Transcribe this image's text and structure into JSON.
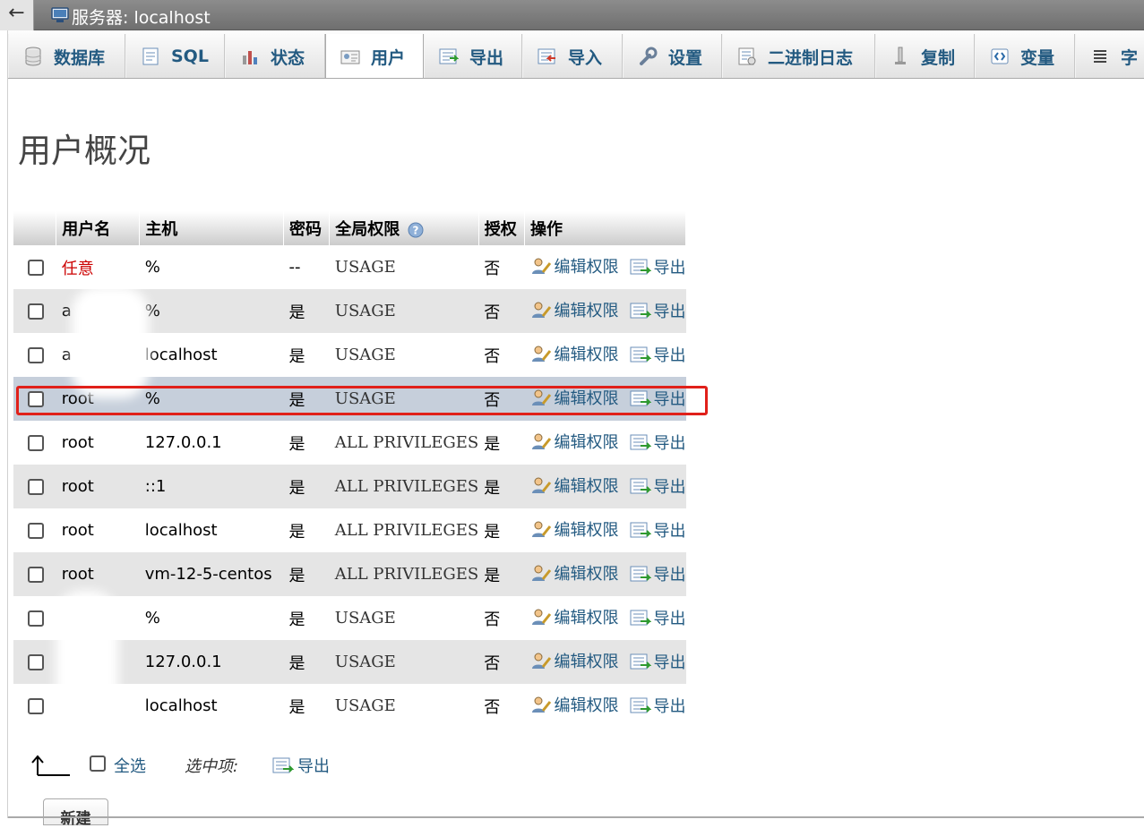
{
  "window": {
    "title": "服务器: localhost",
    "back": "←"
  },
  "tabs": [
    {
      "label": "数据库",
      "icon": "database-icon"
    },
    {
      "label": "SQL",
      "icon": "sql-icon"
    },
    {
      "label": "状态",
      "icon": "status-chart-icon"
    },
    {
      "label": "用户",
      "icon": "users-icon",
      "active": true
    },
    {
      "label": "导出",
      "icon": "export-icon"
    },
    {
      "label": "导入",
      "icon": "import-icon"
    },
    {
      "label": "设置",
      "icon": "wrench-icon"
    },
    {
      "label": "二进制日志",
      "icon": "binlog-icon"
    },
    {
      "label": "复制",
      "icon": "replication-icon"
    },
    {
      "label": "变量",
      "icon": "variables-icon"
    },
    {
      "label": "字",
      "icon": "charset-icon"
    }
  ],
  "page_title": "用户概况",
  "table": {
    "headers": {
      "username": "用户名",
      "host": "主机",
      "password": "密码",
      "global_privileges": "全局权限",
      "grant": "授权",
      "action": "操作"
    },
    "edit_label": "编辑权限",
    "export_label": "导出",
    "rows": [
      {
        "username": "任意",
        "host": "%",
        "password": "--",
        "privileges": "USAGE",
        "grant": "否"
      },
      {
        "username": "a",
        "host": "%",
        "password": "是",
        "privileges": "USAGE",
        "grant": "否"
      },
      {
        "username": "a",
        "host": "localhost",
        "password": "是",
        "privileges": "USAGE",
        "grant": "否"
      },
      {
        "username": "root",
        "host": "%",
        "password": "是",
        "privileges": "USAGE",
        "grant": "否"
      },
      {
        "username": "root",
        "host": "127.0.0.1",
        "password": "是",
        "privileges": "ALL PRIVILEGES",
        "grant": "是"
      },
      {
        "username": "root",
        "host": "::1",
        "password": "是",
        "privileges": "ALL PRIVILEGES",
        "grant": "是"
      },
      {
        "username": "root",
        "host": "localhost",
        "password": "是",
        "privileges": "ALL PRIVILEGES",
        "grant": "是"
      },
      {
        "username": "root",
        "host": "vm-12-5-centos",
        "password": "是",
        "privileges": "ALL PRIVILEGES",
        "grant": "是"
      },
      {
        "username": "",
        "host": "%",
        "password": "是",
        "privileges": "USAGE",
        "grant": "否"
      },
      {
        "username": "",
        "host": "127.0.0.1",
        "password": "是",
        "privileges": "USAGE",
        "grant": "否"
      },
      {
        "username": "",
        "host": "localhost",
        "password": "是",
        "privileges": "USAGE",
        "grant": "否"
      }
    ]
  },
  "footer": {
    "select_all": "全选",
    "with_selected": "选中项:",
    "export": "导出"
  },
  "new_section": "新建",
  "colors": {
    "link": "#235a81",
    "highlight_border": "#e0201a",
    "any_user": "#cc0000"
  }
}
